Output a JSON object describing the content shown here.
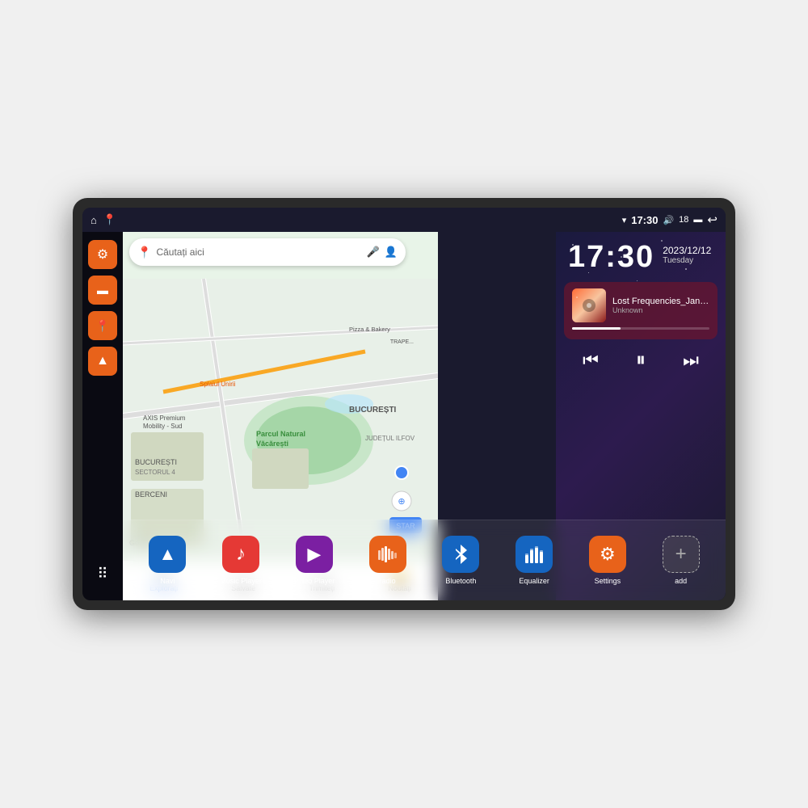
{
  "device": {
    "status_bar": {
      "home_icon": "⌂",
      "map_icon": "📍",
      "wifi_icon": "▾",
      "time": "17:30",
      "volume_icon": "🔊",
      "battery_level": "18",
      "battery_icon": "🔋",
      "back_icon": "↩"
    },
    "sidebar": {
      "items": [
        {
          "id": "settings",
          "icon": "⚙",
          "color": "orange"
        },
        {
          "id": "files",
          "icon": "▬",
          "color": "orange"
        },
        {
          "id": "map",
          "icon": "📍",
          "color": "orange"
        },
        {
          "id": "nav",
          "icon": "▲",
          "color": "orange"
        },
        {
          "id": "apps",
          "icon": "⋯",
          "color": "apps"
        }
      ]
    },
    "map": {
      "search_placeholder": "Căutați aici",
      "locations": [
        "AXIS Premium Mobility - Sud",
        "Pizza & Bakery",
        "Parcul Natural Văcărești",
        "BUCUREȘTI",
        "SECTORUL 4",
        "JUDEȚUL ILFOV",
        "BERCENI"
      ],
      "tabs": [
        {
          "id": "explore",
          "label": "Explorați",
          "icon": "🔍"
        },
        {
          "id": "saved",
          "label": "Salvate",
          "icon": "☆"
        },
        {
          "id": "share",
          "label": "Trimiteți",
          "icon": "↗"
        },
        {
          "id": "news",
          "label": "Noutăți",
          "icon": "🔔"
        }
      ]
    },
    "clock": {
      "time": "17:30",
      "date": "2023/12/12",
      "day": "Tuesday"
    },
    "music": {
      "title": "Lost Frequencies_Janie...",
      "artist": "Unknown",
      "progress": 35
    },
    "apps": [
      {
        "id": "navi",
        "label": "Navi",
        "icon": "▲",
        "class": "app-navi"
      },
      {
        "id": "music",
        "label": "Music Player",
        "icon": "♪",
        "class": "app-music"
      },
      {
        "id": "video",
        "label": "Video Player",
        "icon": "▶",
        "class": "app-video"
      },
      {
        "id": "radio",
        "label": "radio",
        "icon": "📻",
        "class": "app-radio"
      },
      {
        "id": "bluetooth",
        "label": "Bluetooth",
        "icon": "✦",
        "class": "app-bluetooth"
      },
      {
        "id": "equalizer",
        "label": "Equalizer",
        "icon": "≡",
        "class": "app-eq"
      },
      {
        "id": "settings",
        "label": "Settings",
        "icon": "⚙",
        "class": "app-settings"
      },
      {
        "id": "add",
        "label": "add",
        "icon": "+",
        "class": "app-add"
      }
    ]
  }
}
